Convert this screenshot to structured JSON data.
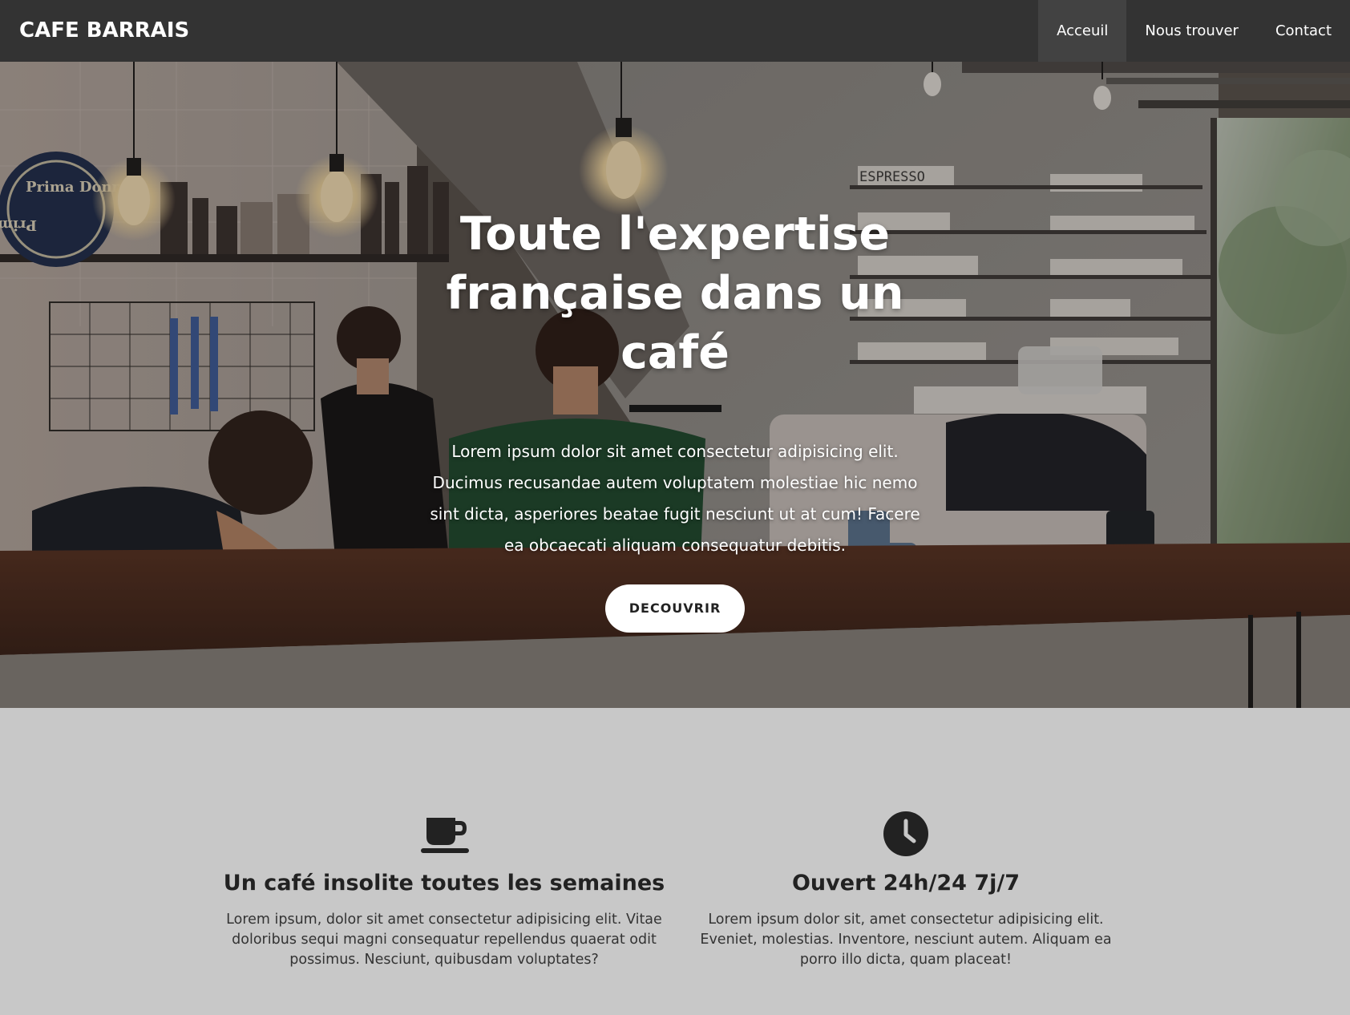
{
  "navbar": {
    "brand": "CAFE BARRAIS",
    "items": [
      {
        "label": "Acceuil",
        "active": true
      },
      {
        "label": "Nous trouver",
        "active": false
      },
      {
        "label": "Contact",
        "active": false
      }
    ]
  },
  "hero": {
    "title": "Toute l'expertise française dans un café",
    "text": "Lorem ipsum dolor sit amet consectetur adipisicing elit. Ducimus recusandae autem voluptatem molestiae hic nemo sint dicta, asperiores beatae fugit nesciunt ut at cum! Facere ea obcaecati aliquam consequatur debitis.",
    "button_label": "DECOUVRIR",
    "shelf_sign": "ESPRESSO",
    "badge_text_top": "Prima Donna",
    "badge_text_bottom": "Prima Donna"
  },
  "features": [
    {
      "icon": "coffee-cup-icon",
      "title": "Un café insolite toutes les semaines",
      "text": "Lorem ipsum, dolor sit amet consectetur adipisicing elit. Vitae doloribus sequi magni consequatur repellendus quaerat odit possimus. Nesciunt, quibusdam voluptates?"
    },
    {
      "icon": "clock-icon",
      "title": "Ouvert 24h/24 7j/7",
      "text": "Lorem ipsum dolor sit, amet consectetur adipisicing elit. Eveniet, molestias. Inventore, nesciunt autem. Aliquam ea porro illo dicta, quam placeat!"
    }
  ],
  "colors": {
    "navbar_bg": "#333333",
    "nav_active_bg": "#424242",
    "page_bg": "#c8c8c8",
    "divider": "#151515"
  }
}
